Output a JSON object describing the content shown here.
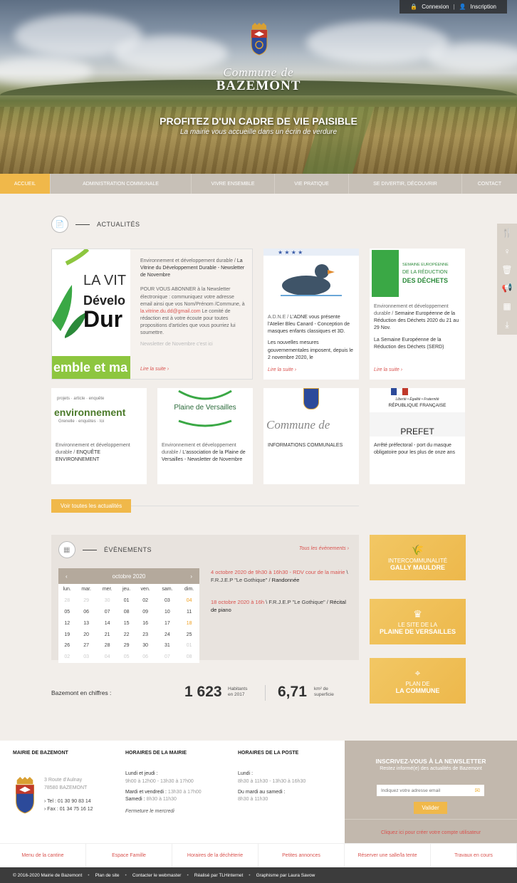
{
  "topbar": {
    "login": "Connexion",
    "signup": "Inscription"
  },
  "hero": {
    "logo_line1": "Commune de",
    "logo_line2": "BAZEMONT",
    "tagline": "PROFITEZ D'UN CADRE DE VIE PAISIBLE",
    "subtagline": "La mairie vous accueille dans un écrin de verdure"
  },
  "nav": {
    "items": [
      "Accueil",
      "Administration communale",
      "Vivre ensemble",
      "Vie pratique",
      "Se divertir, découvrir",
      "Contact"
    ],
    "active_index": 0
  },
  "side_icons": [
    "fork-knife-icon",
    "person-icon",
    "trash-icon",
    "megaphone-icon",
    "shop-icon",
    "download-icon"
  ],
  "news": {
    "section_title": "ACTUALITÉS",
    "featured": {
      "img_line1": "LA VIT",
      "img_line2": "Dévelo",
      "img_line3": "Dur",
      "img_banner": "emble et ma",
      "category": "Environnement et développement durable / ",
      "title": "La Vitrine du Développement Durable - Newsletter de Novembre",
      "body": "POUR VOUS ABONNER à la Newsletter électronique : communiquez votre adresse email ainsi que vos Nom/Prénom /Commune, à ",
      "email": "la.vitrine.du.dd@gmail.com",
      "body2": " Le comité de rédaction est à votre écoute pour toutes propositions d'articles que vous pourriez lui soumettre.",
      "body3": "Newsletter de Novembre c'est ici",
      "more": "Lire la suite"
    },
    "card2": {
      "category": "A.D.N.E / ",
      "title": "L'ADNE vous présente l'Atelier Bleu Canard - Conception de masques enfants classiques et 3D.",
      "excerpt": "Les nouvelles mesures gouvernementales imposent, depuis le 2 novembre 2020, le",
      "more": "Lire la suite"
    },
    "card3": {
      "img_line1": "SEMAINE EUROPÉENNE",
      "img_line2": "DE LA RÉDUCTION",
      "img_line3": "DES DÉCHETS",
      "category": "Environnement et développement durable / ",
      "title": "Semaine Européenne de la Réduction des Déchets 2020 du 21 au 29 Nov.",
      "excerpt": "La Semaine Européenne de la Réduction des Déchets (SERD)",
      "more": "Lire la suite"
    },
    "small_cards": [
      {
        "category": "Environnement et développement durable / ",
        "title": "ENQUÊTE ENVIRONNEMENT",
        "img_word": "environnement"
      },
      {
        "category": "Environnement et développement durable / ",
        "title": "L'association de la Plaine de Versailles - Newsletter de Novembre",
        "img_word": "Plaine de Versailles"
      },
      {
        "category": "",
        "title": "INFORMATIONS COMMUNALES",
        "img_word": "Commune de"
      },
      {
        "category": "",
        "title": "Arrêté préfectoral - port du masque obligatoire pour les plus de onze ans",
        "img_word": "PREFET",
        "img_sub": "Liberté • Égalité • Fraternité",
        "img_sub2": "RÉPUBLIQUE FRANÇAISE"
      }
    ],
    "all_button": "Voir toutes les actualités"
  },
  "events": {
    "section_title": "ÉVÈNEMENTS",
    "all_link": "Tous les évènements",
    "calendar": {
      "month": "octobre 2020",
      "weekdays": [
        "lun.",
        "mar.",
        "mer.",
        "jeu.",
        "ven.",
        "sam.",
        "dim."
      ],
      "weeks": [
        [
          "28",
          "29",
          "30",
          "01",
          "02",
          "03",
          "04"
        ],
        [
          "05",
          "06",
          "07",
          "08",
          "09",
          "10",
          "11"
        ],
        [
          "12",
          "13",
          "14",
          "15",
          "16",
          "17",
          "18"
        ],
        [
          "19",
          "20",
          "21",
          "22",
          "23",
          "24",
          "25"
        ],
        [
          "26",
          "27",
          "28",
          "29",
          "30",
          "31",
          "01"
        ],
        [
          "02",
          "03",
          "04",
          "05",
          "06",
          "07",
          "08"
        ]
      ]
    },
    "items": [
      {
        "date": "4 octobre 2020 de 9h30 à 16h30 - RDV cour de la mairie",
        "org": " \\ F.R.J.E.P \"Le Gothique\" / ",
        "title": "Randonnée"
      },
      {
        "date": "18 octobre 2020 à 16h",
        "org": " \\ F.R.J.E.P \"Le Gothique\" / ",
        "title": "Récital de piano"
      }
    ]
  },
  "figures": {
    "label": "Bazemont en chiffres :",
    "stat1_value": "1 623",
    "stat1_label_a": "Habitants",
    "stat1_label_b": "en 2017",
    "stat2_value": "6,71",
    "stat2_label_a": "km² de",
    "stat2_label_b": "superficie"
  },
  "promos": [
    {
      "line1": "INTERCOMMUNALITÉ",
      "line2": "GALLY MAULDRE",
      "icon": "wheat-icon"
    },
    {
      "line1": "LE SITE DE LA",
      "line2": "PLAINE DE VERSAILLES",
      "icon": "crown-icon"
    },
    {
      "line1": "PLAN DE",
      "line2": "LA COMMUNE",
      "icon": "map-pin-icon"
    }
  ],
  "footer": {
    "mairie_title": "MAIRIE DE BAZEMONT",
    "address1": "3 Route d'Aulnay",
    "address2": "78580 BAZEMONT",
    "tel": "› Tel : 01 30 90 83 14",
    "fax": "› Fax : 01 34 75 16 12",
    "hours_title": "HORAIRES DE LA MAIRIE",
    "hours1_day": "Lundi et jeudi :",
    "hours1_time": "9h00 à 12h00 - 13h30 à 17h00",
    "hours2_day": "Mardi et vendredi : ",
    "hours2_time": "13h30 à 17h00",
    "hours3_day": "Samedi : ",
    "hours3_time": "8h30 à 11h30",
    "hours_note": "Fermeture le mercredi",
    "post_title": "HORAIRES DE LA POSTE",
    "post1_day": "Lundi :",
    "post1_time": "8h30 à 11h30 - 13h30 à 16h30",
    "post2_day": "Du mardi au samedi :",
    "post2_time": "8h30 à 11h30"
  },
  "newsletter": {
    "title": "INSCRIVEZ-VOUS À LA NEWSLETTER",
    "subtitle": "Restez informé(e) des actualités de Bazemont",
    "placeholder": "Indiquez votre adresse email",
    "button": "Valider",
    "create_account": "Cliquez ici pour créer votre compte utilisateur"
  },
  "quick_links": [
    "Menu de la cantine",
    "Espace Famille",
    "Horaires de la déchèterie",
    "Petites annonces",
    "Réserver une salle/la tente",
    "Travaux en cours"
  ],
  "bottom_bar": [
    "© 2016-2020 Mairie de Bazemont",
    "Plan de site",
    "Contacter le webmaster",
    "Réalisé par TLHinternet",
    "Graphisme par Laura Savow"
  ],
  "colors": {
    "accent": "#f0b84a",
    "link_red": "#d9534f",
    "nav_bg": "#c7c0b7"
  }
}
